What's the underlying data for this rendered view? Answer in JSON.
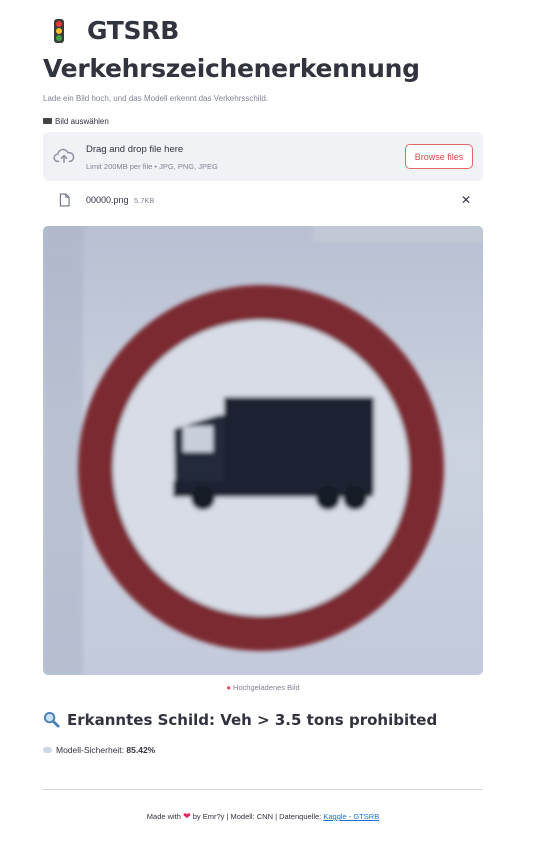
{
  "header": {
    "title": "GTSRB Verkehrszeichenerkennung",
    "subtitle": "Lade ein Bild hoch, und das Modell erkennt das Verkehrsschild."
  },
  "uploader": {
    "label": "Bild auswählen",
    "drop_title": "Drag and drop file here",
    "drop_limits": "Limit 200MB per file • JPG, PNG, JPEG",
    "browse_label": "Browse files",
    "file": {
      "name": "00000.png",
      "size": "5.7KB"
    },
    "remove_symbol": "✕"
  },
  "image": {
    "caption": "Hochgeladenes Bild",
    "sign_type": "no-trucks prohibition sign"
  },
  "result": {
    "heading": "Erkanntes Schild: Veh > 3.5 tons prohibited",
    "confidence_label": "Modell-Sicherheit:",
    "confidence_value": "85.42%"
  },
  "footer": {
    "made_with": "Made with",
    "by_text": "by Emr?y | Modell: CNN | Datenquelle:",
    "link_text": "Kaggle - GTSRB"
  },
  "colors": {
    "accent": "#e0464a",
    "sign_ring": "#8f2a2e",
    "sign_bg": "#c7cfdd",
    "link": "#1c6fd1"
  },
  "icons": {
    "title": "traffic-light-icon",
    "uploader": "camera-icon",
    "dropzone": "cloud-upload-icon",
    "file": "file-icon",
    "caption": "pin-icon",
    "result": "magnifier-icon",
    "confidence": "speech-bubble-icon",
    "footer": "heart-icon"
  }
}
